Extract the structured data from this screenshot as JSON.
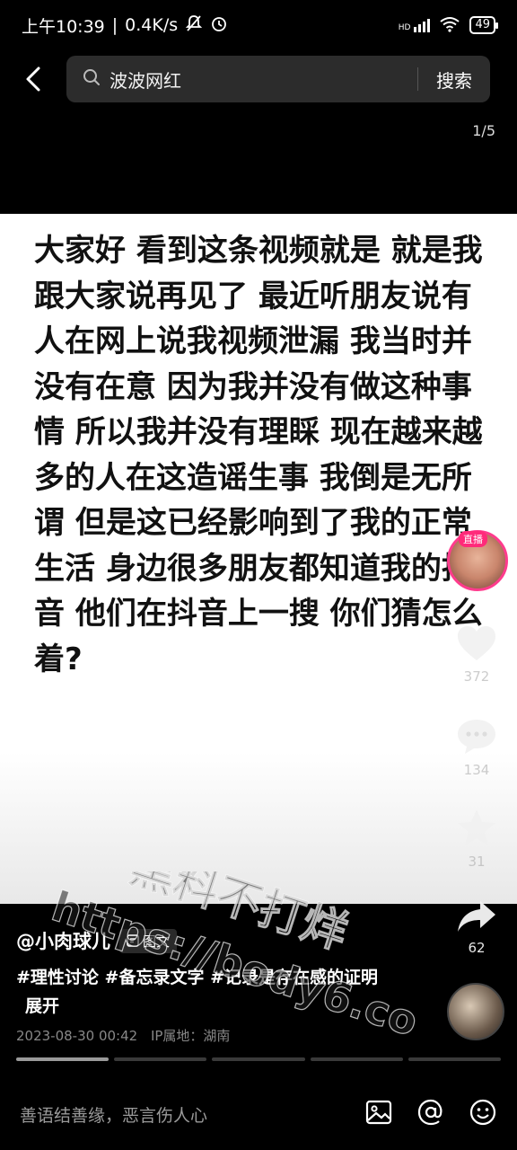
{
  "status": {
    "time": "上午10:39",
    "speed": "0.4K/s",
    "network": "HD",
    "battery": "49"
  },
  "search": {
    "query": "波波网红",
    "button": "搜索"
  },
  "page_counter": "1/5",
  "post": {
    "body": "大家好 看到这条视频就是 就是我跟大家说再见了 最近听朋友说有人在网上说我视频泄漏 我当时并没有在意 因为我并没有做这种事情 所以我并没有理睬 现在越来越多的人在这造谣生事 我倒是无所谓 但是这已经影响到了我的正常生活 身边很多朋友都知道我的抖音 他们在抖音上一搜 你们猜怎么着?"
  },
  "live_badge": "直播",
  "actions": {
    "like_count": "372",
    "comment_count": "134",
    "favorite_count": "31",
    "share_count": "62"
  },
  "author": {
    "name": "@小肉球儿",
    "type_badge": "图文"
  },
  "tags_text": "#理性讨论 #备忘录文字 #记录是存在感的证明",
  "expand_label": "展开",
  "meta": {
    "datetime": "2023-08-30 00:42",
    "ip_location": "IP属地：湖南"
  },
  "comment_placeholder": "善语结善缘，恶言伤人心",
  "watermark": {
    "line1": "黑料不打烊",
    "line2": "https://body6.co"
  },
  "progress": {
    "total": 5,
    "current": 1
  }
}
